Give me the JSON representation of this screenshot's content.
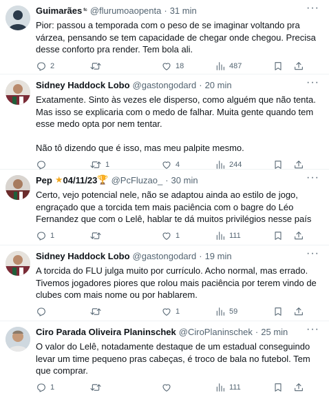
{
  "tweets": [
    {
      "name": "Guimarães",
      "badge": "ᶠᶜ",
      "handle": "@flurumoaopenta",
      "time": "31 min",
      "text": "Pior: passou a temporada com o peso de se imaginar voltando pra várzea, pensando se tem capacidade de chegar onde chegou. Precisa desse conforto pra render. Tem bola ali.",
      "replies": "2",
      "retweets": "",
      "likes": "18",
      "views": "487",
      "avatar_color": "#2b3a4a"
    },
    {
      "name": "Sidney Haddock Lobo",
      "badge": "",
      "handle": "@gastongodard",
      "time": "20 min",
      "text": "Exatamente. Sinto às vezes ele disperso, como alguém que não tenta. Mas isso se explicaria com o medo de falhar. Muita gente quando tem esse medo opta por nem tentar.\n\nNão tô dizendo que é isso, mas meu palpite mesmo.",
      "replies": "",
      "retweets": "1",
      "likes": "4",
      "views": "244",
      "avatar_color": "#7a2b36"
    },
    {
      "name": "Pep",
      "name_suffix": "04/11/23",
      "handle": "@PcFluzao_",
      "time": "30 min",
      "text": "Certo, vejo potencial nele, não se adaptou ainda ao estilo de jogo, engraçado que a torcida tem mais paciência com o bagre do Léo Fernandez que com o Lelê, hablar te dá muitos privilégios nesse país",
      "replies": "1",
      "retweets": "",
      "likes": "1",
      "views": "111",
      "avatar_color": "#6b2c2c"
    },
    {
      "name": "Sidney Haddock Lobo",
      "badge": "",
      "handle": "@gastongodard",
      "time": "19 min",
      "text": "A torcida do FLU julga muito por currículo. Acho normal, mas errado. Tivemos jogadores piores que rolou mais paciência por terem vindo de clubes com mais nome ou por hablarem.",
      "replies": "",
      "retweets": "",
      "likes": "1",
      "views": "59",
      "avatar_color": "#7a2b36"
    },
    {
      "name": "Ciro Parada Oliveira Planinschek",
      "badge": "",
      "handle": "@CiroPlaninschek",
      "time": "25 min",
      "text": "O valor do Lelê, notadamente destaque de um estadual conseguindo levar um time pequeno pras cabeças, é troco de bala no futebol. Tem que comprar.",
      "replies": "1",
      "retweets": "",
      "likes": "",
      "views": "111",
      "avatar_color": "#8a7a6a"
    }
  ],
  "icons": {
    "more": "more-icon",
    "reply": "reply-icon",
    "retweet": "retweet-icon",
    "like": "like-icon",
    "views": "views-icon",
    "bookmark": "bookmark-icon",
    "share": "share-icon"
  }
}
